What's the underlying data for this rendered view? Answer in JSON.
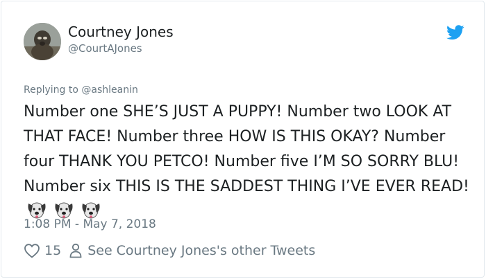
{
  "author": {
    "name": "Courtney Jones",
    "handle": "@CourtAJones"
  },
  "reply_to": "Replying to @ashleanin",
  "tweet": {
    "text": "Number one SHE’S JUST A PUPPY! Number two LOOK AT THAT FACE! Number three HOW IS THIS OKAY? Number four THANK YOU PETCO! Number five I’M SO SORRY BLU! Number six THIS IS THE SADDEST THING I’VE EVER READ!",
    "emoji": [
      "dog-face",
      "dog-face",
      "dog-face"
    ]
  },
  "timestamp": "1:08 PM - May 7, 2018",
  "actions": {
    "like_count": "15",
    "other_tweets_label": "See Courtney Jones's other Tweets"
  },
  "colors": {
    "text": "#1c2022",
    "secondary": "#697882",
    "twitter_blue": "#1da1f2",
    "border": "#e1e8ed"
  },
  "icons": {
    "brand": "twitter-bird-icon",
    "like": "heart-icon",
    "profile": "person-icon"
  }
}
